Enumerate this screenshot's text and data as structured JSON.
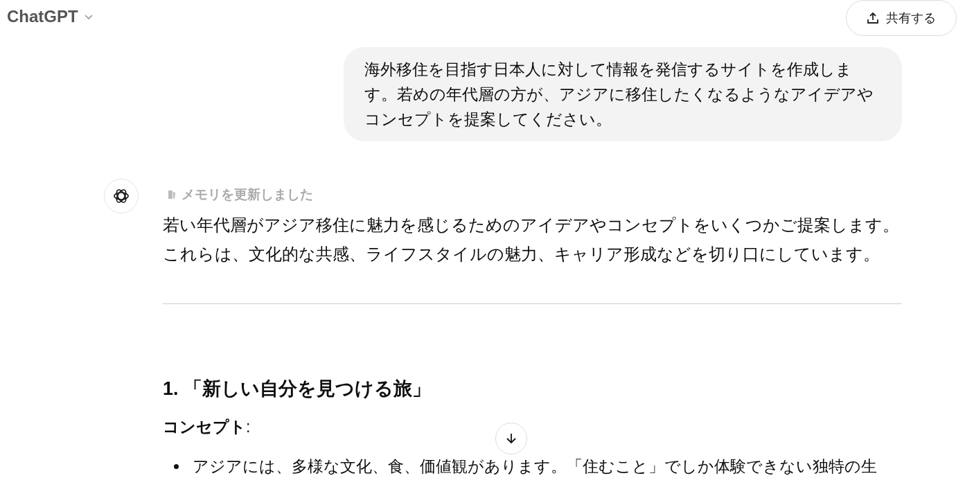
{
  "header": {
    "title": "ChatGPT",
    "share_button": "共有する"
  },
  "user_message": "海外移住を目指す日本人に対して情報を発信するサイトを作成します。若めの年代層の方が、アジアに移住したくなるようなアイデアやコンセプトを提案してください。",
  "assistant": {
    "memory_note": "メモリを更新しました",
    "intro": "若い年代層がアジア移住に魅力を感じるためのアイデアやコンセプトをいくつかご提案します。これらは、文化的な共感、ライフスタイルの魅力、キャリア形成などを切り口にしています。",
    "heading": "1. 「新しい自分を見つける旅」",
    "label": "**コンセプト**:",
    "bullets": [
      "アジアには、多様な文化、食、価値観があります。「住むこと」でしか体験できない独特の生"
    ]
  }
}
